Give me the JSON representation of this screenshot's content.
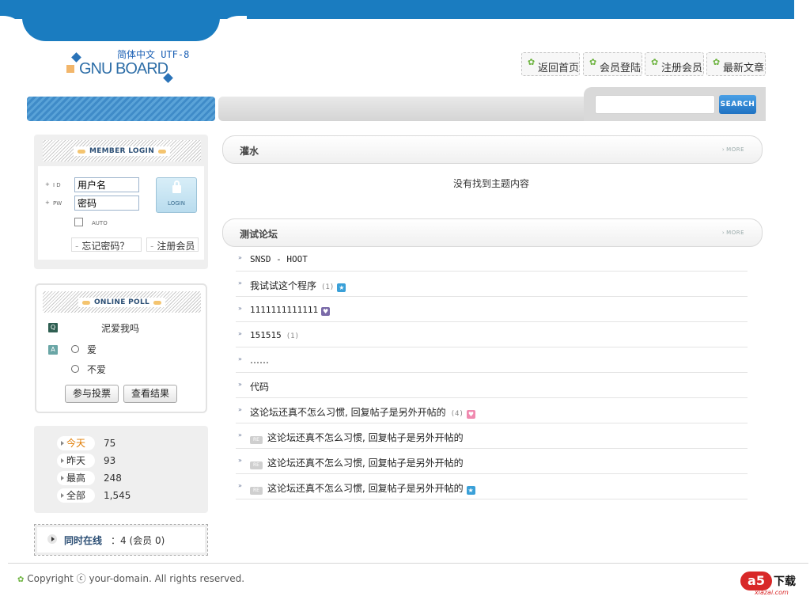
{
  "logo": {
    "charset": "简体中文 UTF-8",
    "brand": "GNU BOARD"
  },
  "nav": [
    {
      "label": "返回首页"
    },
    {
      "label": "会员登陆"
    },
    {
      "label": "注册会员"
    },
    {
      "label": "最新文章"
    }
  ],
  "search": {
    "button": "SEARCH",
    "value": ""
  },
  "login": {
    "title": "MEMBER LOGIN",
    "id_label": "I D",
    "pw_label": "PW",
    "id_value": "用户名",
    "pw_value": "密码",
    "login_button": "LOGIN",
    "auto_label": "AUTO",
    "forgot": "忘记密码？",
    "register": "注册会员"
  },
  "poll": {
    "title": "ONLINE POLL",
    "q_badge": "Q",
    "a_badge": "A",
    "question": "泥爱我吗",
    "options": [
      "爱",
      "不爱"
    ],
    "vote_button": "参与投票",
    "result_button": "查看结果"
  },
  "visitors": [
    {
      "label": "今天",
      "value": "75",
      "color": "#e07b00"
    },
    {
      "label": "昨天",
      "value": "93",
      "color": "#333333"
    },
    {
      "label": "最高",
      "value": "248",
      "color": "#333333"
    },
    {
      "label": "全部",
      "value": "1,545",
      "color": "#333333"
    }
  ],
  "online": {
    "label": "同时在线",
    "value": "：4 (会员 0)"
  },
  "sections": [
    {
      "title": "灌水",
      "more": "MORE",
      "empty_text": "没有找到主题内容"
    },
    {
      "title": "测试论坛",
      "more": "MORE"
    }
  ],
  "posts": [
    {
      "title": "SNSD - HOOT",
      "count": "",
      "icon": "",
      "reply": false
    },
    {
      "title": "我试试这个程序",
      "count": "(1)",
      "icon": "star",
      "reply": false
    },
    {
      "title": "1111111111111",
      "count": "",
      "icon": "heart-purple",
      "reply": false
    },
    {
      "title": "151515",
      "count": "(1)",
      "icon": "",
      "reply": false
    },
    {
      "title": "……",
      "count": "",
      "icon": "",
      "reply": false
    },
    {
      "title": "代码",
      "count": "",
      "icon": "",
      "reply": false
    },
    {
      "title": "这论坛还真不怎么习惯, 回复帖子是另外开帖的",
      "count": "(4)",
      "icon": "heart-pink",
      "reply": false
    },
    {
      "title": "这论坛还真不怎么习惯, 回复帖子是另外开帖的",
      "count": "",
      "icon": "",
      "reply": true
    },
    {
      "title": "这论坛还真不怎么习惯, 回复帖子是另外开帖的",
      "count": "",
      "icon": "",
      "reply": true
    },
    {
      "title": "这论坛还真不怎么习惯, 回复帖子是另外开帖的",
      "count": "",
      "icon": "star",
      "reply": true
    }
  ],
  "reply_badge": "RE",
  "footer": {
    "copyright": "Copyright ⓒ your-domain. All rights reserved."
  },
  "watermark": {
    "brand": "a5",
    "download": "下载",
    "site": "xiazai.com"
  },
  "colors": {
    "primary": "#1a7cc0",
    "accent": "#e07b00"
  }
}
